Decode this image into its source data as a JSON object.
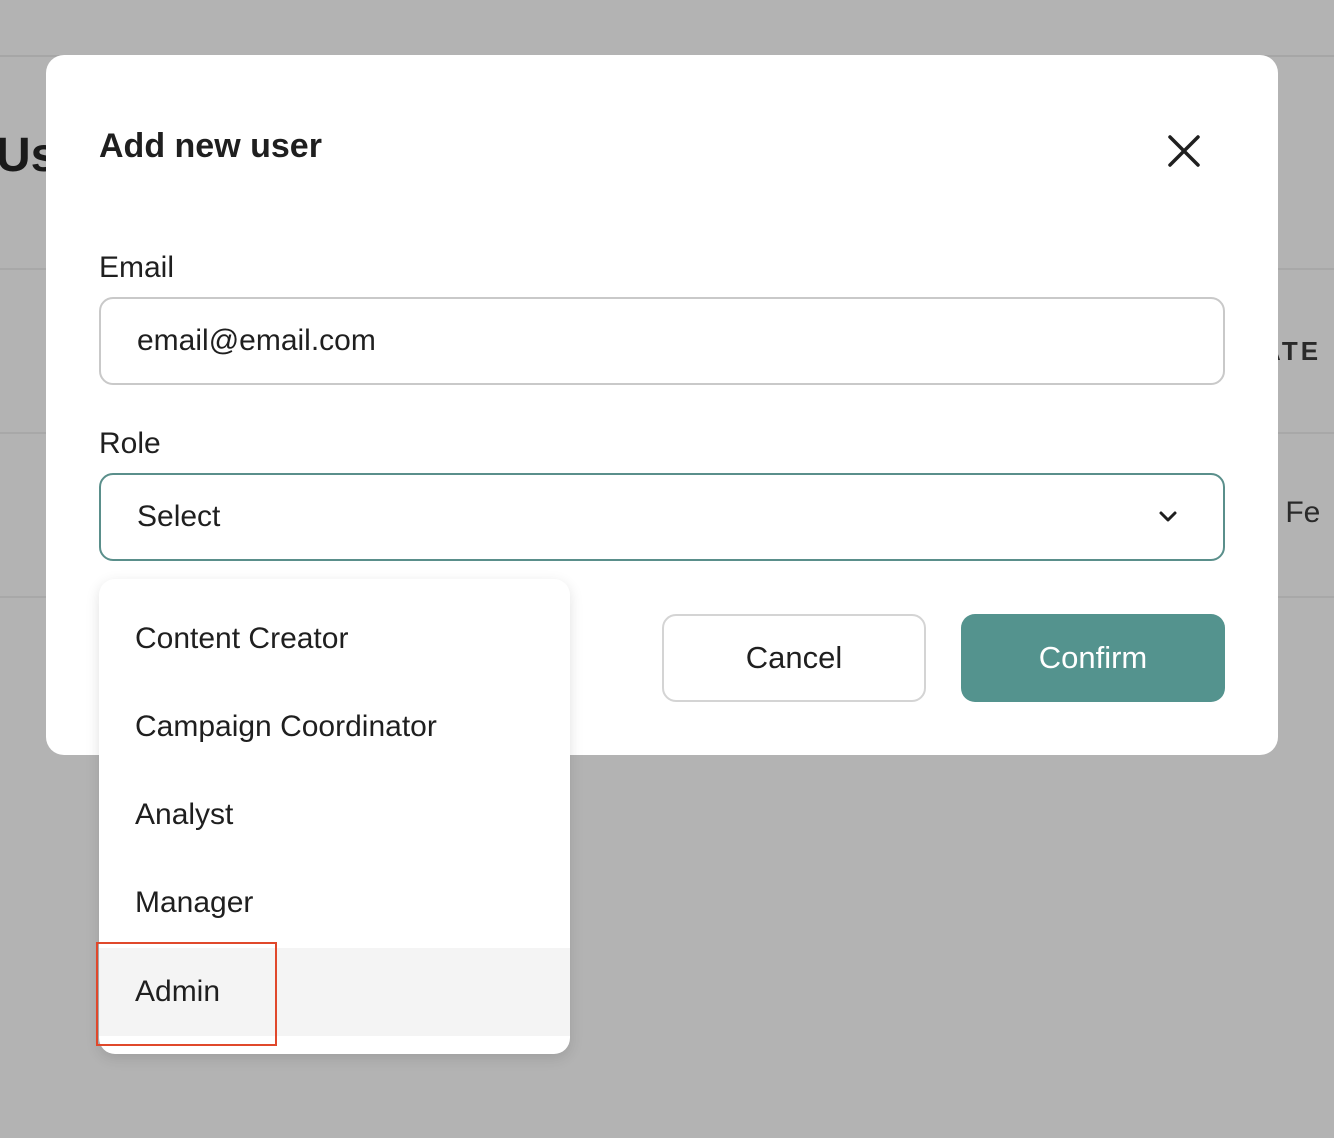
{
  "background": {
    "page_title_fragment": "Us",
    "column_header_fragment": "ATE",
    "cell_fragment": "i, Fe"
  },
  "modal": {
    "title": "Add new user",
    "close_icon": "close-icon",
    "email": {
      "label": "Email",
      "value": "email@email.com"
    },
    "role": {
      "label": "Role",
      "selected": "Select",
      "chevron_icon": "chevron-down-icon"
    },
    "cancel_label": "Cancel",
    "confirm_label": "Confirm"
  },
  "dropdown": {
    "options": [
      "Content Creator",
      "Campaign Coordinator",
      "Analyst",
      "Manager",
      "Admin"
    ],
    "hovered_option": "Admin"
  },
  "colors": {
    "accent": "#54938e",
    "select_border": "#5a8f8b",
    "highlight": "#e0482b",
    "overlay": "#b3b3b3"
  }
}
